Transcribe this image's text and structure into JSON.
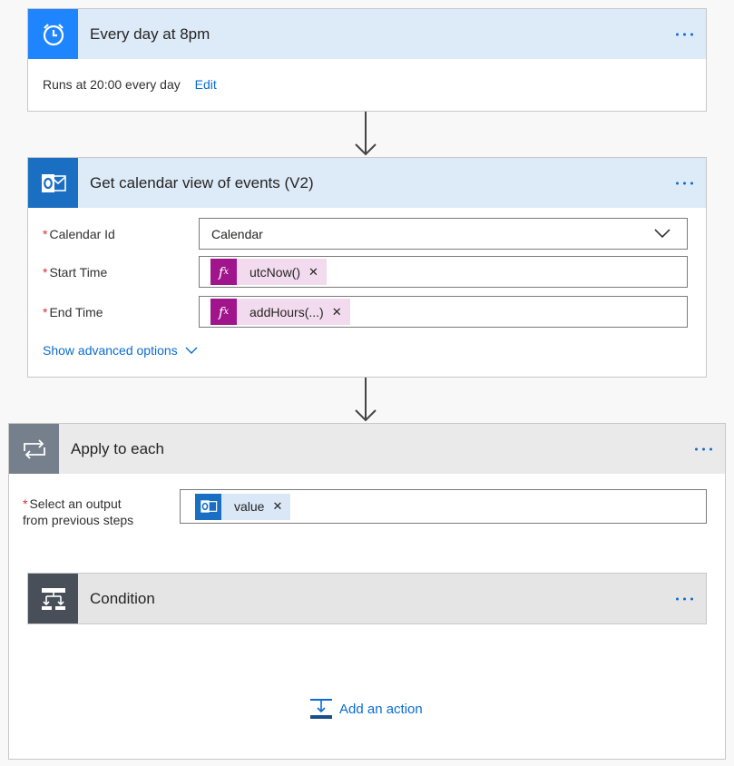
{
  "trigger": {
    "title": "Every day at 8pm",
    "description": "Runs at 20:00 every day",
    "edit_label": "Edit",
    "icon": "alarm-clock-icon"
  },
  "outlook": {
    "title": "Get calendar view of events (V2)",
    "icon": "outlook-icon",
    "fields": {
      "calendar_id": {
        "label": "Calendar Id",
        "value": "Calendar"
      },
      "start_time": {
        "label": "Start Time",
        "token": "utcNow()"
      },
      "end_time": {
        "label": "End Time",
        "token": "addHours(...)"
      }
    },
    "advanced_label": "Show advanced options"
  },
  "apply": {
    "title": "Apply to each",
    "icon": "loop-icon",
    "select_label_line1": "Select an output",
    "select_label_line2": "from previous steps",
    "token": "value"
  },
  "condition": {
    "title": "Condition",
    "icon": "condition-icon"
  },
  "add_action_label": "Add an action",
  "colors": {
    "accent": "#0a6cd3",
    "trigger_icon_bg": "#1f85ff",
    "outlook_blue": "#1b6fc2",
    "expression_purple": "#a0158b",
    "required": "#d13438"
  }
}
